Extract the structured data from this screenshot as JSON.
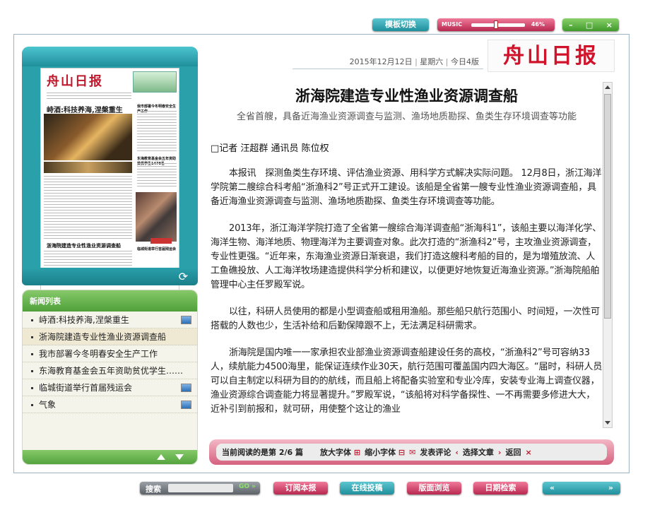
{
  "top": {
    "template_switch": "模板切换",
    "music_label": "MUSIC",
    "volume": "46%",
    "window_controls": [
      "–",
      "□",
      "×"
    ]
  },
  "paper_thumb": {
    "masthead": "舟山日报",
    "headline1": "峙酒:科技养海,涅槃重生",
    "headline2": "浙海院建造专业性渔业资源调查船",
    "side1": "我市部署今冬明春安全生产工作",
    "side2": "东海教育基金会五年资助贫优学生1478名",
    "side3": "临城街道举行首届残运会"
  },
  "news": {
    "header": "新闻列表",
    "items": [
      {
        "label": "峙酒:科技养海,涅槃重生",
        "has_image": true
      },
      {
        "label": "浙海院建造专业性渔业资源调查船",
        "has_image": false
      },
      {
        "label": "我市部署今冬明春安全生产工作",
        "has_image": false
      },
      {
        "label": "东海教育基金会五年资助贫优学生……",
        "has_image": false
      },
      {
        "label": "临城街道举行首届残运会",
        "has_image": true
      },
      {
        "label": "气象",
        "has_image": true
      }
    ]
  },
  "header": {
    "date": "2015年12月12日",
    "weekday": "星期六",
    "edition": "今日4版",
    "brand": "舟山日报"
  },
  "article": {
    "title": "浙海院建造专业性渔业资源调查船",
    "subtitle": "全省首艘，具备近海渔业资源调查与监测、渔场地质勘探、鱼类生存环境调查等功能",
    "byline": "□记者 汪超群 通讯员 陈位权",
    "paragraphs": [
      "本报讯　探测鱼类生存环境、评估渔业资源、用科学方式解决实际问题。 12月8日，浙江海洋学院第二艘综合科考船“浙渔科2”号正式开工建设。该船是全省第一艘专业性渔业资源调查船，具备近海渔业资源调查与监测、渔场地质勘探、鱼类生存环境调查等功能。",
      "2013年，浙江海洋学院打造了全省第一艘综合海洋调查船“浙海科1”，该船主要以海洋化学、海洋生物、海洋地质、物理海洋为主要调查对象。此次打造的“浙渔科2”号，主攻渔业资源调查，专业性更强。“近年来，东海渔业资源日渐衰退，我们打造这艘科考船的目的，是为增殖放流、人工鱼礁投放、人工海洋牧场建造提供科学分析和建议，以便更好地恢复近海渔业资源。”浙海院船舶管理中心主任罗殿军说。",
      "以往，科研人员使用的都是小型调查船或租用渔船。那些船只航行范围小、时间短，一次性可搭载的人数也少，生活补给和后勤保障跟不上，无法满足科研需求。",
      "浙海院是国内唯一一家承担农业部渔业资源调查船建设任务的高校，“浙渔科2”号可容纳33人，续航能力4500海里，能保证连续作业30天，航行范围可覆盖国内四大海区。“届时，科研人员可以自主制定以科研为目的的航线，而且船上将配备实验室和专业冷库，安装专业海上调查仪器，渔业资源综合调查能力将显著提升。”罗殿军说，“该船将对科学备探性、一不再需要多修进大大，近补引到前报和，就可研，用使整个这让的渔业"
    ]
  },
  "reader_bar": {
    "status_prefix": "当前阅读的是第",
    "status_value": "2/6",
    "status_suffix": "篇",
    "enlarge": "放大字体",
    "shrink": "缩小字体",
    "comment": "发表评论",
    "select": "选择文章",
    "back": "返回"
  },
  "bottom": {
    "search_label": "搜索",
    "search_value": "",
    "go": "GO",
    "subscribe": "订阅本报",
    "submit": "在线投稿",
    "browse": "版面浏览",
    "date_search": "日期检索",
    "prev": "«",
    "next": "»"
  }
}
